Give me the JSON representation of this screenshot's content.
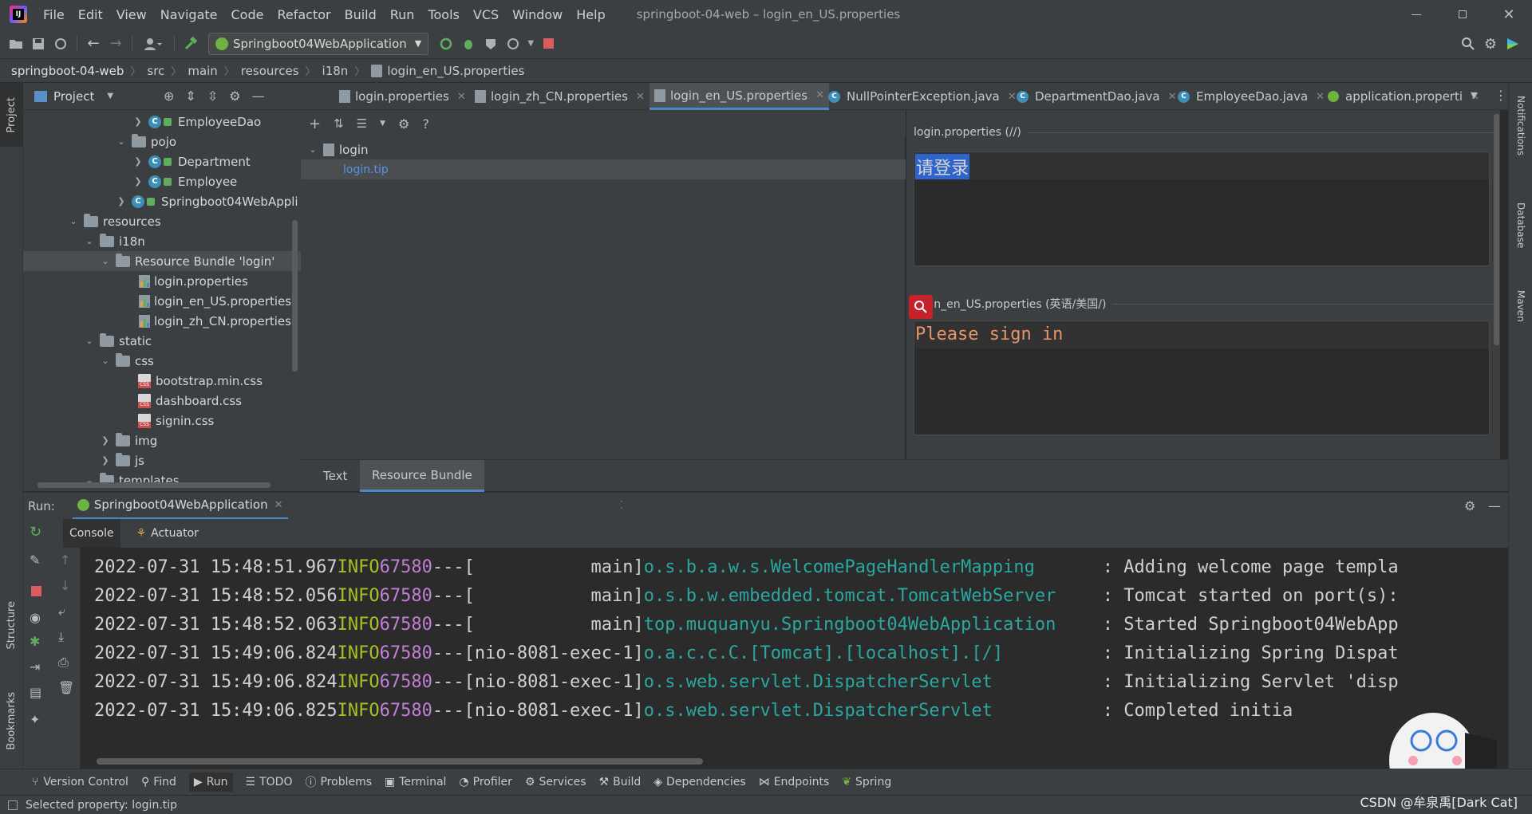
{
  "menu": {
    "items": [
      "File",
      "Edit",
      "View",
      "Navigate",
      "Code",
      "Refactor",
      "Build",
      "Run",
      "Tools",
      "VCS",
      "Window",
      "Help"
    ],
    "window_title": "springboot-04-web – login_en_US.properties"
  },
  "toolbar": {
    "run_config": "Springboot04WebApplication"
  },
  "breadcrumb": [
    "springboot-04-web",
    "src",
    "main",
    "resources",
    "i18n",
    "login_en_US.properties"
  ],
  "left_stripe": {
    "project": "Project",
    "structure": "Structure",
    "bookmarks": "Bookmarks"
  },
  "right_stripe": {
    "notifications": "Notifications",
    "database": "Database",
    "maven": "Maven"
  },
  "project_panel": {
    "title": "Project",
    "tree": [
      {
        "label": "EmployeeDao",
        "kind": "class"
      },
      {
        "label": "pojo",
        "kind": "folder"
      },
      {
        "label": "Department",
        "kind": "class"
      },
      {
        "label": "Employee",
        "kind": "class"
      },
      {
        "label": "Springboot04WebAppli",
        "kind": "class"
      },
      {
        "label": "resources",
        "kind": "folder"
      },
      {
        "label": "i18n",
        "kind": "folder"
      },
      {
        "label": "Resource Bundle 'login'",
        "kind": "bundle"
      },
      {
        "label": "login.properties",
        "kind": "props"
      },
      {
        "label": "login_en_US.properties",
        "kind": "props"
      },
      {
        "label": "login_zh_CN.properties",
        "kind": "props"
      },
      {
        "label": "static",
        "kind": "folder"
      },
      {
        "label": "css",
        "kind": "folder"
      },
      {
        "label": "bootstrap.min.css",
        "kind": "css"
      },
      {
        "label": "dashboard.css",
        "kind": "css"
      },
      {
        "label": "signin.css",
        "kind": "css"
      },
      {
        "label": "img",
        "kind": "folder"
      },
      {
        "label": "js",
        "kind": "folder"
      },
      {
        "label": "templates",
        "kind": "folder"
      }
    ]
  },
  "editor_tabs": [
    {
      "label": "login.properties",
      "active": false
    },
    {
      "label": "login_zh_CN.properties",
      "active": false
    },
    {
      "label": "login_en_US.properties",
      "active": true
    },
    {
      "label": "NullPointerException.java",
      "active": false
    },
    {
      "label": "DepartmentDao.java",
      "active": false
    },
    {
      "label": "EmployeeDao.java",
      "active": false
    },
    {
      "label": "application.properti",
      "active": false
    }
  ],
  "resource_bundle": {
    "root": "login",
    "selected_key": "login.tip",
    "default_header": "login.properties (//)",
    "default_value": "请登录",
    "en_header": "login_en_US.properties (英语/美国/)",
    "en_value": "Please sign in"
  },
  "rb_bottom_tabs": [
    "Text",
    "Resource Bundle"
  ],
  "run_panel": {
    "label": "Run:",
    "config": "Springboot04WebApplication",
    "subtabs": [
      "Console",
      "Actuator"
    ]
  },
  "console_lines": [
    {
      "ts": "2022-07-31 15:48:51.967",
      "level": "INFO",
      "pid": "67580",
      "sep": "---",
      "thread": "[           main]",
      "logger": "o.s.b.a.w.s.WelcomePageHandlerMapping",
      "msg": ": Adding welcome page templa"
    },
    {
      "ts": "2022-07-31 15:48:52.056",
      "level": "INFO",
      "pid": "67580",
      "sep": "---",
      "thread": "[           main]",
      "logger": "o.s.b.w.embedded.tomcat.TomcatWebServer",
      "msg": ": Tomcat started on port(s):"
    },
    {
      "ts": "2022-07-31 15:48:52.063",
      "level": "INFO",
      "pid": "67580",
      "sep": "---",
      "thread": "[           main]",
      "logger": "top.muquanyu.Springboot04WebApplication",
      "msg": ": Started Springboot04WebApp"
    },
    {
      "ts": "2022-07-31 15:49:06.824",
      "level": "INFO",
      "pid": "67580",
      "sep": "---",
      "thread": "[nio-8081-exec-1]",
      "logger": "o.a.c.c.C.[Tomcat].[localhost].[/]",
      "msg": ": Initializing Spring Dispat"
    },
    {
      "ts": "2022-07-31 15:49:06.824",
      "level": "INFO",
      "pid": "67580",
      "sep": "---",
      "thread": "[nio-8081-exec-1]",
      "logger": "o.s.web.servlet.DispatcherServlet",
      "msg": ": Initializing Servlet 'disp"
    },
    {
      "ts": "2022-07-31 15:49:06.825",
      "level": "INFO",
      "pid": "67580",
      "sep": "---",
      "thread": "[nio-8081-exec-1]",
      "logger": "o.s.web.servlet.DispatcherServlet",
      "msg": ": Completed initia"
    }
  ],
  "tool_stripe": [
    "Version Control",
    "Find",
    "Run",
    "TODO",
    "Problems",
    "Terminal",
    "Profiler",
    "Services",
    "Build",
    "Dependencies",
    "Endpoints",
    "Spring"
  ],
  "status": {
    "text": "Selected property: login.tip",
    "watermark": "CSDN @牟泉禹[Dark Cat]"
  },
  "colors": {
    "accent": "#4a88c7",
    "selection": "#2f65ca",
    "log_level": "#a8c023",
    "log_pid": "#c27fd5",
    "log_logger": "#2aa7a0",
    "rb_value": "#cc7832"
  }
}
